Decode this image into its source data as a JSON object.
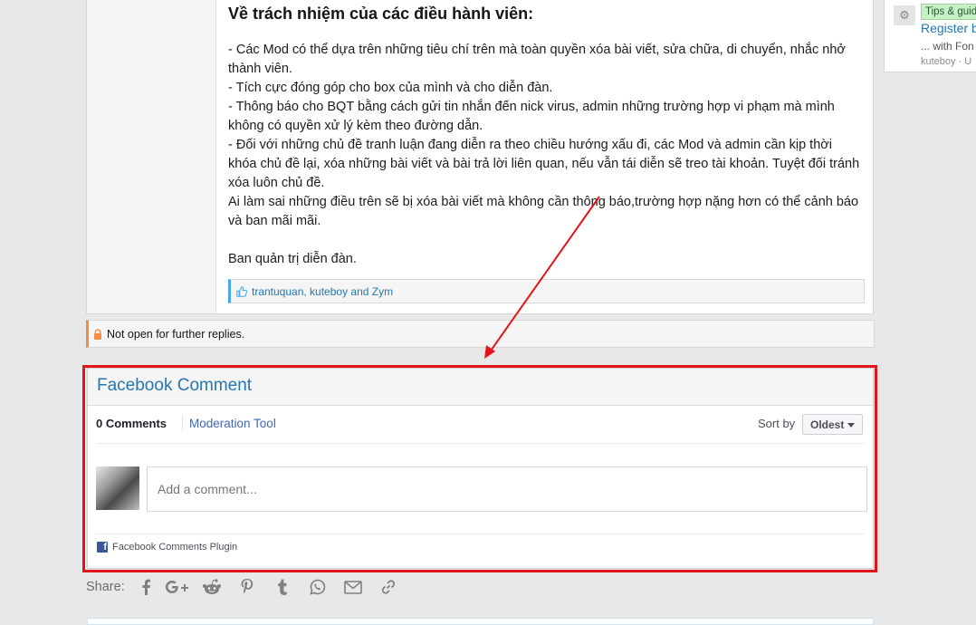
{
  "post": {
    "title": "Về trách nhiệm của các điều hành viên:",
    "paragraphs": [
      "- Các Mod có thể dựa trên những tiêu chí trên mà toàn quyền xóa bài viết, sửa chữa, di chuyển, nhắc nhở thành viên.",
      "- Tích cực đóng góp cho box của mình và cho diễn đàn.",
      "- Thông báo cho BQT bằng cách gửi tin nhắn đến nick virus, admin những trường hợp vi phạm mà mình không có quyền xử lý kèm theo đường dẫn.",
      "- Đối với những chủ đề tranh luận đang diễn ra theo chiều hướng xấu đi, các Mod và admin cần kịp thời khóa chủ đề lại, xóa những bài viết và bài trả lời liên quan, nếu vẫn tái diễn sẽ treo tài khoản. Tuyệt đối tránh xóa luôn chủ đề.",
      "Ai làm sai những điều trên sẽ bị xóa bài viết mà không cần thông báo,trường hợp nặng hơn có thể cảnh báo và ban mãi mãi."
    ],
    "signature": "Ban quản trị diễn đàn.",
    "likes": "trantuquan, kuteboy and Zym"
  },
  "notice": {
    "text": "Not open for further replies."
  },
  "sidebar": {
    "tag": "Tips & guides",
    "link": "Register b",
    "sub": "... with Fon",
    "meta": "kuteboy · U"
  },
  "facebook": {
    "title": "Facebook Comment",
    "count_label": "0 Comments",
    "moderation_label": "Moderation Tool",
    "sort_label": "Sort by",
    "sort_value": "Oldest",
    "input_placeholder": "Add a comment...",
    "plugin_label": "Facebook Comments Plugin"
  },
  "share": {
    "label": "Share:",
    "icons": [
      "facebook-icon",
      "google-plus-icon",
      "reddit-icon",
      "pinterest-icon",
      "tumblr-icon",
      "whatsapp-icon",
      "email-icon",
      "link-icon"
    ]
  },
  "colors": {
    "accent_blue": "#2577b1",
    "highlight_red": "#e3141b",
    "notice_orange": "#f78c40",
    "facebook_blue": "#3b5998"
  }
}
